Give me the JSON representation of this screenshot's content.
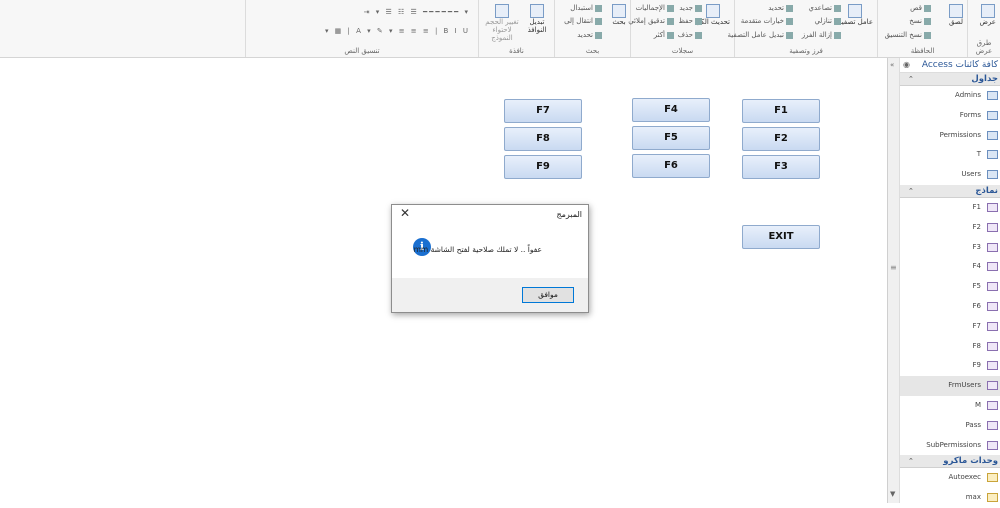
{
  "ribbon": {
    "groups": {
      "views": {
        "label": "طرق عرض",
        "button": "عرض"
      },
      "clipboard": {
        "label": "الحافظة",
        "paste": "لصق",
        "cut": "قص",
        "copy": "نسخ",
        "format_painter": "نسخ التنسيق"
      },
      "sort_filter": {
        "label": "فرز وتصفية",
        "filter": "عامل تصفية",
        "ascending": "تصاعدي",
        "descending": "تنازلي",
        "remove_sort": "إزالة الفرز",
        "selection": "تحديد",
        "advanced": "خيارات متقدمة",
        "toggle_filter": "تبديل عامل التصفية"
      },
      "records": {
        "label": "سجلات",
        "refresh_all": "تحديث الكل",
        "new": "جديد",
        "save": "حفظ",
        "delete": "حذف",
        "totals": "الإجماليات",
        "spelling": "تدقيق إملائي",
        "more": "أكثر"
      },
      "find": {
        "label": "بحث",
        "find": "بحث",
        "replace": "استبدال",
        "goto": "انتقال إلى",
        "select": "تحديد"
      },
      "window": {
        "label": "نافذة",
        "size_to_fit": "تغيير الحجم لاحتواء النموذج",
        "switch_windows": "تبديل النوافذ"
      },
      "text_format": {
        "label": "تنسيق النص"
      }
    }
  },
  "form_buttons": {
    "f1": "F1",
    "f2": "F2",
    "f3": "F3",
    "f4": "F4",
    "f5": "F5",
    "f6": "F6",
    "f7": "F7",
    "f8": "F8",
    "f9": "F9",
    "exit": "EXIT"
  },
  "nav": {
    "header": "كافة كائنات Access",
    "tables_title": "جداول",
    "tables": [
      "Admins",
      "Forms",
      "Permissions",
      "T",
      "Users"
    ],
    "forms_title": "نماذج",
    "forms": [
      "F1",
      "F2",
      "F3",
      "F4",
      "F5",
      "F6",
      "F7",
      "F8",
      "F9",
      "FrmUsers",
      "M",
      "Pass",
      "SubPermissions"
    ],
    "selected_form": "FrmUsers",
    "macros_title": "وحدات ماكرو",
    "macros": [
      "Autoexec",
      "max"
    ]
  },
  "dialog": {
    "title": "المبرمج",
    "message": "عفواً .. لا تملك صلاحية لفتح الشاشة  mm",
    "ok": "موافق"
  },
  "colors": {
    "accent": "#2b5797",
    "info": "#1a6fd0",
    "button_bg": "#c9daf1"
  }
}
